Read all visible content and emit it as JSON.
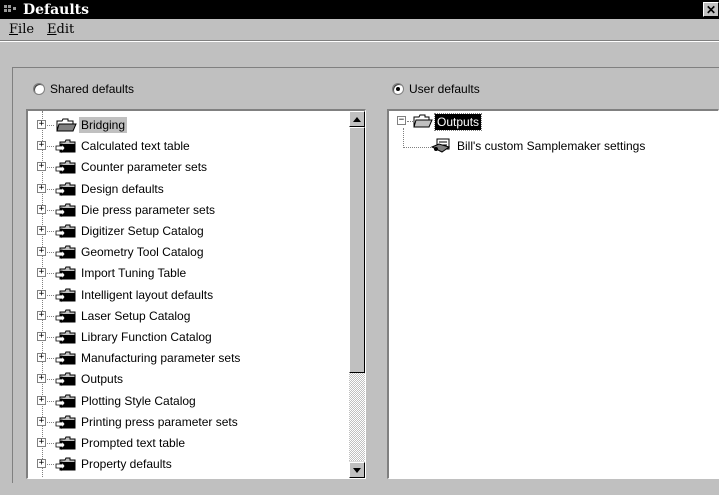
{
  "window": {
    "title": "Defaults",
    "close_label": "✕"
  },
  "menu": {
    "items": [
      {
        "label": "File",
        "accel": "F",
        "rest": "ile"
      },
      {
        "label": "Edit",
        "accel": "E",
        "rest": "dit"
      }
    ]
  },
  "shared": {
    "radio_label": "Shared defaults",
    "selected": false,
    "items": [
      "Bridging",
      "Calculated text table",
      "Counter parameter sets",
      "Design defaults",
      "Die press parameter sets",
      "Digitizer Setup Catalog",
      "Geometry Tool Catalog",
      "Import Tuning Table",
      "Intelligent layout defaults",
      "Laser Setup Catalog",
      "Library Function Catalog",
      "Manufacturing parameter sets",
      "Outputs",
      "Plotting Style Catalog",
      "Printing press parameter sets",
      "Prompted text table",
      "Property defaults"
    ],
    "selected_item": "Bridging"
  },
  "user": {
    "radio_label": "User defaults",
    "selected": true,
    "root": "Outputs",
    "children": [
      "Bill's custom Samplemaker settings"
    ]
  },
  "icons": {
    "folder_closed": "folder-icon",
    "folder_open": "open-folder-icon",
    "settings": "settings-file-icon"
  },
  "colors": {
    "face": "#c0c0c0",
    "titlebar": "#000000",
    "panel": "#ffffff"
  }
}
